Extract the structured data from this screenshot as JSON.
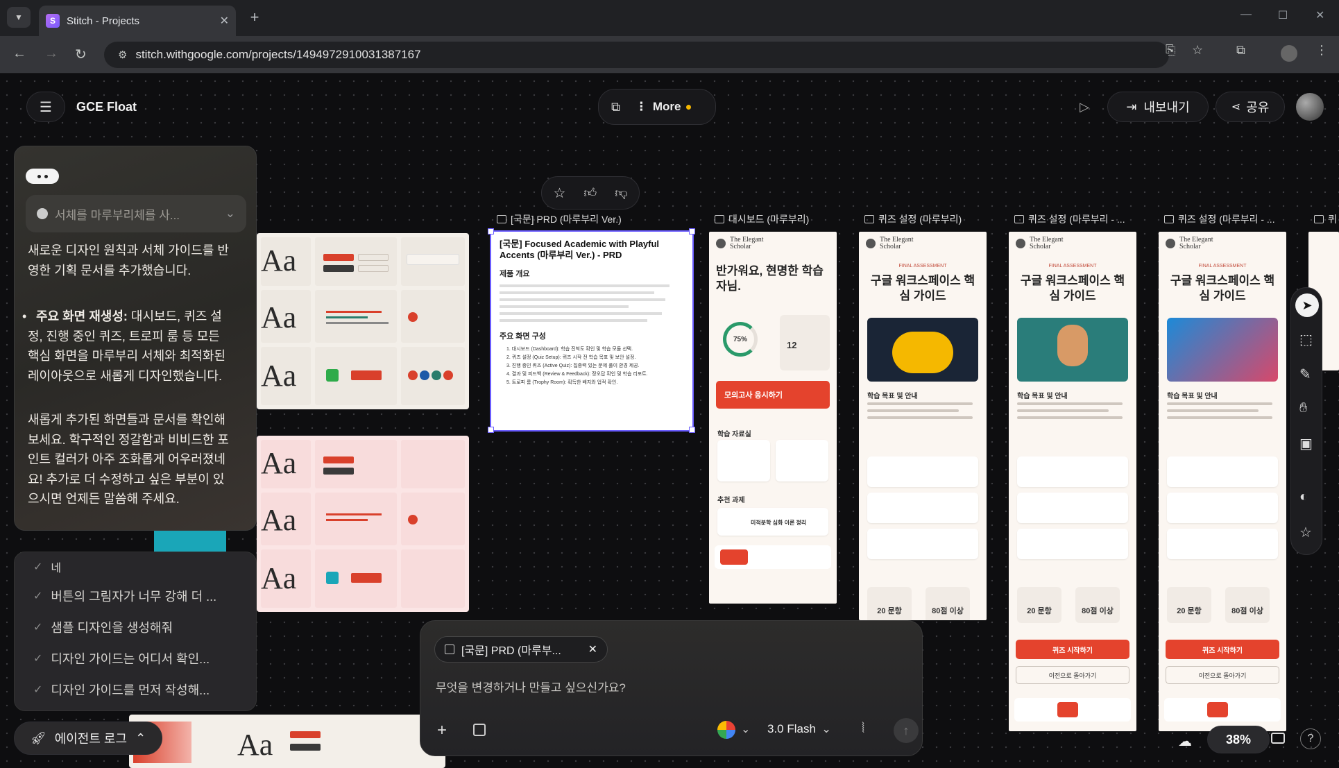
{
  "browser": {
    "tab_title": "Stitch - Projects",
    "url": "stitch.withgoogle.com/projects/1494972910031387167"
  },
  "header": {
    "project_name": "GCE Float",
    "more_label": "More",
    "export_label": "내보내기",
    "share_label": "공유"
  },
  "chat": {
    "thread_selector": "서체를 마루부리체를 사...",
    "message_intro": "새로운 디자인 원칙과 서체 가이드를 반영한 기획 문서를 추가했습니다.",
    "bullet_bold": "주요 화면 재생성:",
    "bullet_text": " 대시보드, 퀴즈 설정, 진행 중인 퀴즈, 트로피 룸 등 모든 핵심 화면을 마루부리 서체와 최적화된 레이아웃으로 새롭게 디자인했습니다.",
    "message_outro": "새롭게 추가된 화면들과 문서를 확인해 보세요. 학구적인 정갈함과 비비드한 포인트 컬러가 아주 조화롭게 어우러졌네요! 추가로 더 수정하고 싶은 부분이 있으시면 언제든 말씀해 주세요."
  },
  "history": {
    "items": [
      "네",
      "버튼의 그림자가 너무 강해 더 ...",
      "샘플 디자인을 생성해줘",
      "디자인 가이드는 어디서 확인...",
      "디자인 가이드를 먼저 작성해..."
    ],
    "agent_log_label": "에이전트 로그"
  },
  "artboards": {
    "labels": [
      "[국문] PRD (마루부리 Ver.)",
      "대시보드 (마루부리)",
      "퀴즈 설정 (마루부리)",
      "퀴즈 설정 (마루부리 - ...",
      "퀴즈 설정 (마루부리 - ...",
      "퀴"
    ],
    "prd": {
      "title": "[국문] Focused Academic with Playful Accents (마루부리 Ver.) - PRD",
      "section1": "제품 개요",
      "section2": "주요 화면 구성",
      "items": [
        "1. 대시보드 (Dashboard): 학습 진척도 확인 및 학습 모듈 선택.",
        "2. 퀴즈 설정 (Quiz Setup): 퀴즈 시작 전 학습 목표 및 보안 설정.",
        "3. 진행 중인 퀴즈 (Active Quiz): 집중력 있는 문제 풀이 환경 제공.",
        "4. 결과 및 피드백 (Review & Feedback): 정오답 확인 및 학습 리포트.",
        "5. 트로피 룸 (Trophy Room): 획득한 배지와 업적 확인."
      ]
    },
    "brand": "The Elegant Scholar",
    "dashboard": {
      "greeting": "반가워요, 현명한 학습자님.",
      "progress": "75%",
      "streak": "12",
      "cta": "모의고사 응시하기",
      "materials": "학습 자료실",
      "recommended": "추천 과제",
      "recommended_item": "미적분학 심화 이론 정리"
    },
    "quiz": {
      "title": "구글 워크스페이스 핵심 가이드",
      "tag": "FINAL ASSESSMENT",
      "objective": "학습 목표 및 안내",
      "stat1": "20 문항",
      "stat2": "80점 이상",
      "start": "퀴즈 시작하기",
      "back": "이전으로 돌아가기"
    }
  },
  "prompt": {
    "chip_label": "[국문] PRD (마루부...",
    "placeholder": "무엇을 변경하거나 만들고 싶으신가요?",
    "model": "3.0 Flash"
  },
  "zoom": "38%",
  "colors": {
    "accent": "#e4432d",
    "selection": "#6a5cff",
    "more_dot": "#f5b700"
  }
}
